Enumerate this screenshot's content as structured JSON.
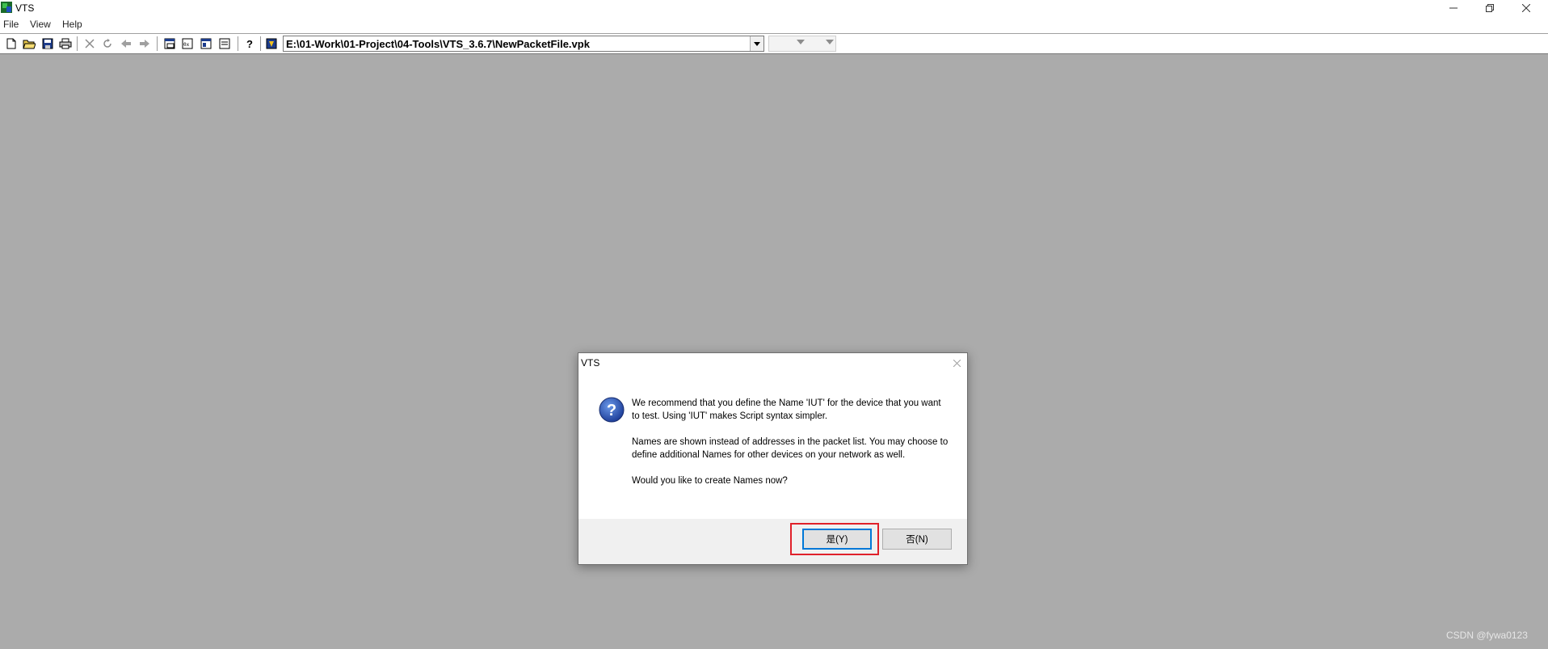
{
  "window": {
    "title": "VTS"
  },
  "menu": {
    "items": [
      "File",
      "View",
      "Help"
    ]
  },
  "toolbar": {
    "path": "E:\\01-Work\\01-Project\\04-Tools\\VTS_3.6.7\\NewPacketFile.vpk"
  },
  "dialog": {
    "title": "VTS",
    "message": [
      "We recommend that you define the Name 'IUT' for the device that you want to test.  Using 'IUT' makes Script syntax simpler.",
      "Names are shown instead of addresses in the packet list.  You may choose to define additional Names for other devices on your network as well.",
      "Would you like to create Names now?"
    ],
    "yes_label": "是(Y)",
    "no_label": "否(N)"
  },
  "watermark": "CSDN @fywa0123",
  "colors": {
    "desktop": "#ababab",
    "highlight": "#e0202a",
    "focus": "#0078d7"
  }
}
